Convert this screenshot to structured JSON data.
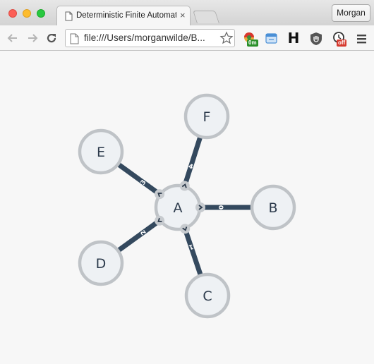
{
  "tab": {
    "title": "Deterministic Finite Automaton",
    "close_glyph": "×"
  },
  "profile": {
    "name": "Morgan"
  },
  "address_bar": {
    "url": "file:///Users/morganwilde/B..."
  },
  "extensions": [
    {
      "icon": "colorful-extension-icon",
      "badge": "0m",
      "badge_color": "#2a8f2a"
    },
    {
      "icon": "folder-window-icon"
    },
    {
      "icon": "h-letter-icon",
      "text": "H"
    },
    {
      "icon": "hand-shield-icon"
    },
    {
      "icon": "clock-icon",
      "badge": "off",
      "badge_color": "#d63a2f"
    },
    {
      "icon": "menu-icon"
    }
  ],
  "graph": {
    "nodes": [
      {
        "id": "A",
        "label": "A"
      },
      {
        "id": "B",
        "label": "B"
      },
      {
        "id": "C",
        "label": "C"
      },
      {
        "id": "D",
        "label": "D"
      },
      {
        "id": "E",
        "label": "E"
      },
      {
        "id": "F",
        "label": "F"
      }
    ],
    "edges": [
      {
        "from": "A",
        "to": "B",
        "label": "0"
      },
      {
        "from": "A",
        "to": "C",
        "label": "1"
      },
      {
        "from": "A",
        "to": "D",
        "label": "2"
      },
      {
        "from": "A",
        "to": "E",
        "label": "3"
      },
      {
        "from": "A",
        "to": "F",
        "label": "4"
      }
    ],
    "colors": {
      "node_fill": "#eef1f4",
      "node_stroke": "#bfc3c7",
      "edge": "#34495e",
      "connector_fill": "#c7cbcf",
      "label_text": "#2c3a4b"
    }
  }
}
